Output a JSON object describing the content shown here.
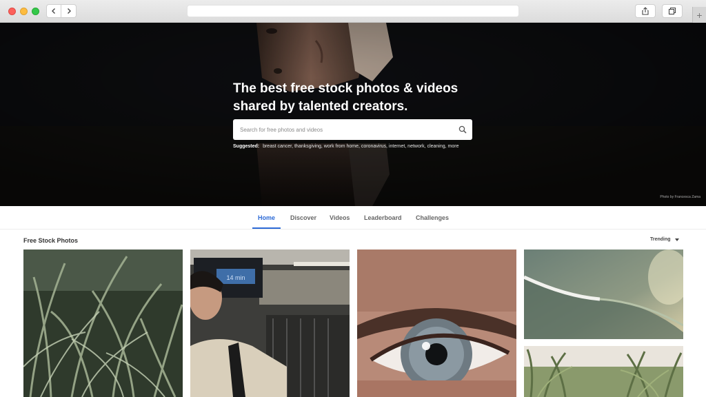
{
  "hero": {
    "title": "The best free stock photos & videos shared by talented creators.",
    "search_placeholder": "Search for free photos and videos",
    "suggested_label": "Suggested:",
    "suggested_terms": "breast cancer, thanksgiving, work from home, coronavirus, internet, network, cleaning, more",
    "photo_credit": "Photo by Francesca Zama"
  },
  "tabs": [
    {
      "label": "Home"
    },
    {
      "label": "Discover"
    },
    {
      "label": "Videos"
    },
    {
      "label": "Leaderboard"
    },
    {
      "label": "Challenges"
    }
  ],
  "gallery": {
    "title": "Free Stock Photos",
    "sort_label": "Trending",
    "sign_text": "14 min"
  },
  "colors": {
    "accent": "#2c6ad6",
    "hero_bg": "#0e0f12"
  }
}
